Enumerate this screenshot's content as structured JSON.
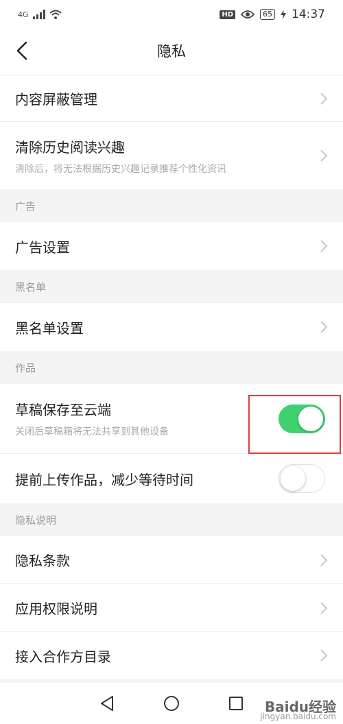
{
  "status_bar": {
    "network": "4G",
    "hd": "HD",
    "battery": "65",
    "time": "14:37"
  },
  "header": {
    "title": "隐私"
  },
  "top_items": [
    {
      "title": "内容屏蔽管理",
      "subtitle": ""
    },
    {
      "title": "清除历史阅读兴趣",
      "subtitle": "清除后，将无法根据历史兴趣记录推荐个性化资讯"
    }
  ],
  "sections": {
    "ads": {
      "header": "广告",
      "items": [
        {
          "title": "广告设置"
        }
      ]
    },
    "blacklist": {
      "header": "黑名单",
      "items": [
        {
          "title": "黑名单设置"
        }
      ]
    },
    "works": {
      "header": "作品",
      "items": [
        {
          "title": "草稿保存至云端",
          "subtitle": "关闭后草稿箱将无法共享到其他设备",
          "toggle": "on"
        },
        {
          "title": "提前上传作品，减少等待时间",
          "toggle": "off"
        }
      ]
    },
    "privacy_info": {
      "header": "隐私说明",
      "items": [
        {
          "title": "隐私条款"
        },
        {
          "title": "应用权限说明"
        },
        {
          "title": "接入合作方目录"
        }
      ]
    }
  },
  "colors": {
    "toggle_on": "#3fd070",
    "highlight": "#e53935"
  },
  "watermark": {
    "brand": "Baidu经验",
    "url": "jingyan.baidu.com"
  }
}
